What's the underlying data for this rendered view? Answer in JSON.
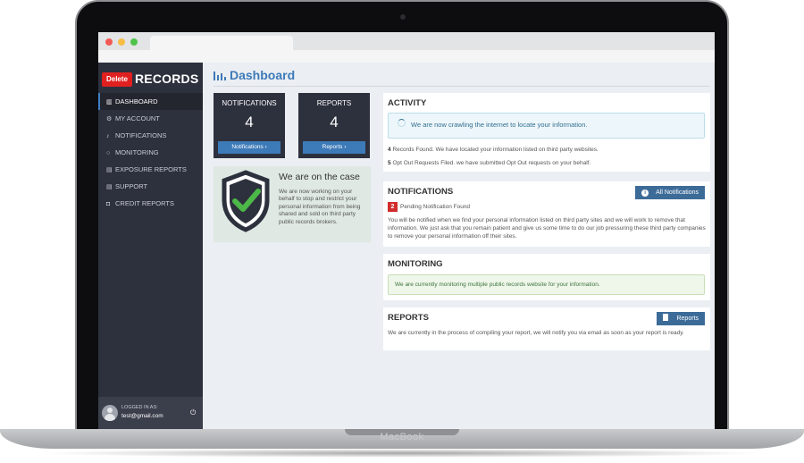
{
  "device": {
    "brand": "MacBook"
  },
  "sidebar": {
    "logo_badge": "Delete",
    "logo_text": "RECORDS",
    "items": [
      {
        "label": "DASHBOARD",
        "icon": "bar-chart-icon",
        "active": true
      },
      {
        "label": "MY ACCOUNT",
        "icon": "gear-icon"
      },
      {
        "label": "NOTIFICATIONS",
        "icon": "bell-icon"
      },
      {
        "label": "MONITORING",
        "icon": "search-icon"
      },
      {
        "label": "EXPOSURE REPORTS",
        "icon": "document-icon"
      },
      {
        "label": "SUPPORT",
        "icon": "document-icon"
      },
      {
        "label": "CREDIT REPORTS",
        "icon": "car-icon"
      }
    ],
    "footer": {
      "logged_label": "LOGGED IN AS:",
      "email": "test@gmail.com",
      "icon": "power-icon"
    }
  },
  "main": {
    "title": "Dashboard",
    "title_icon": "bar-chart-icon",
    "stats": [
      {
        "label": "NOTIFICATIONS",
        "value": "4",
        "button": "Notifications ›"
      },
      {
        "label": "REPORTS",
        "value": "4",
        "button": "Reports ›"
      }
    ],
    "case": {
      "title": "We are on the case",
      "text": "We are now working on your behalf to stop and restrict your personal information from being shared and sold on third party public records brokers.",
      "icon": "shield-check-icon"
    },
    "activity": {
      "title": "ACTIVITY",
      "status": "We are now crawling the internet to locate your information.",
      "line1_count": "4",
      "line1_text": "Records Found. We have located your information listed on third party websites.",
      "line2_count": "5",
      "line2_text": "Opt Out Requests Filed. we have submitted Opt Out requests on your behalf."
    },
    "notifications": {
      "title": "NOTIFICATIONS",
      "button": "All Notifications",
      "pending_count": "2",
      "pending_text": "Pending Notification Found",
      "text": "You will be notified when we find your personal information listed on third party sites and we will work to remove that information. We just ask that you remain patient and give us some time to do our job pressuring these third party companies to remove your personal information off their sites."
    },
    "monitoring": {
      "title": "MONITORING",
      "status": "We are currently monitoring multiple public records website for your information."
    },
    "reports": {
      "title": "REPORTS",
      "button": "Reports",
      "text": "We are currently in the process of compiling your report, we will notify you via email as soon as your report is ready."
    }
  },
  "colors": {
    "sidebar": "#2d303d",
    "accent": "#3d7ab8",
    "badge_red": "#d12c2c",
    "logo_red": "#e02020"
  }
}
